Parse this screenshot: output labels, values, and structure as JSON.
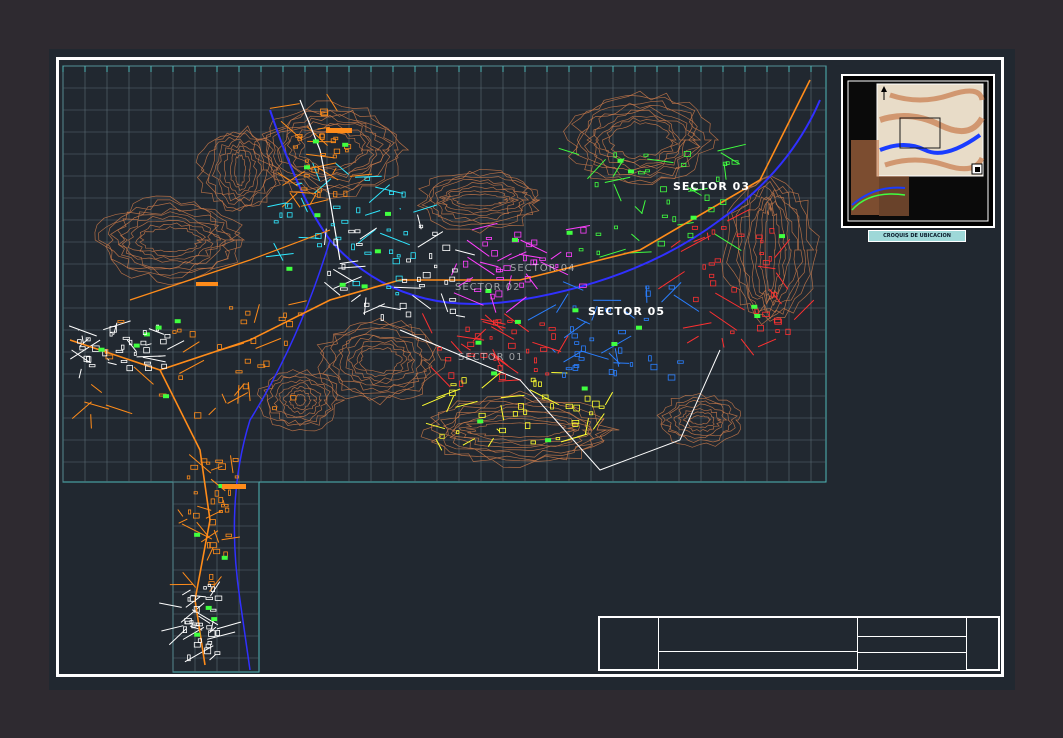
{
  "drawing": {
    "background_color": "#2e2a30",
    "model_color": "#212830",
    "grid_color": "#4fb8b8",
    "contour_color": "#c8794a",
    "street_colors": [
      "#ff8c1a",
      "#ffffff",
      "#ff3030",
      "#ff40ff",
      "#30e8ff",
      "#2a7fff",
      "#40ff40",
      "#ffff30",
      "#3030ff"
    ],
    "sectors": [
      {
        "label": "SECTOR  03",
        "color": "#ffffff"
      },
      {
        "label": "SECTOR  05",
        "color": "#ffffff"
      },
      {
        "label": "SECTOR  04",
        "color": "#ffffff"
      },
      {
        "label": "SECTOR  01",
        "color": "#ffffff"
      },
      {
        "label": "SECTOR  02",
        "color": "#ffffff"
      }
    ]
  },
  "location_sketch": {
    "caption": "CROQUIS DE UBICACION",
    "north_arrow_icon": "north-arrow-icon"
  },
  "title_block": {
    "cells": [
      "",
      "",
      "",
      "",
      "",
      ""
    ]
  }
}
